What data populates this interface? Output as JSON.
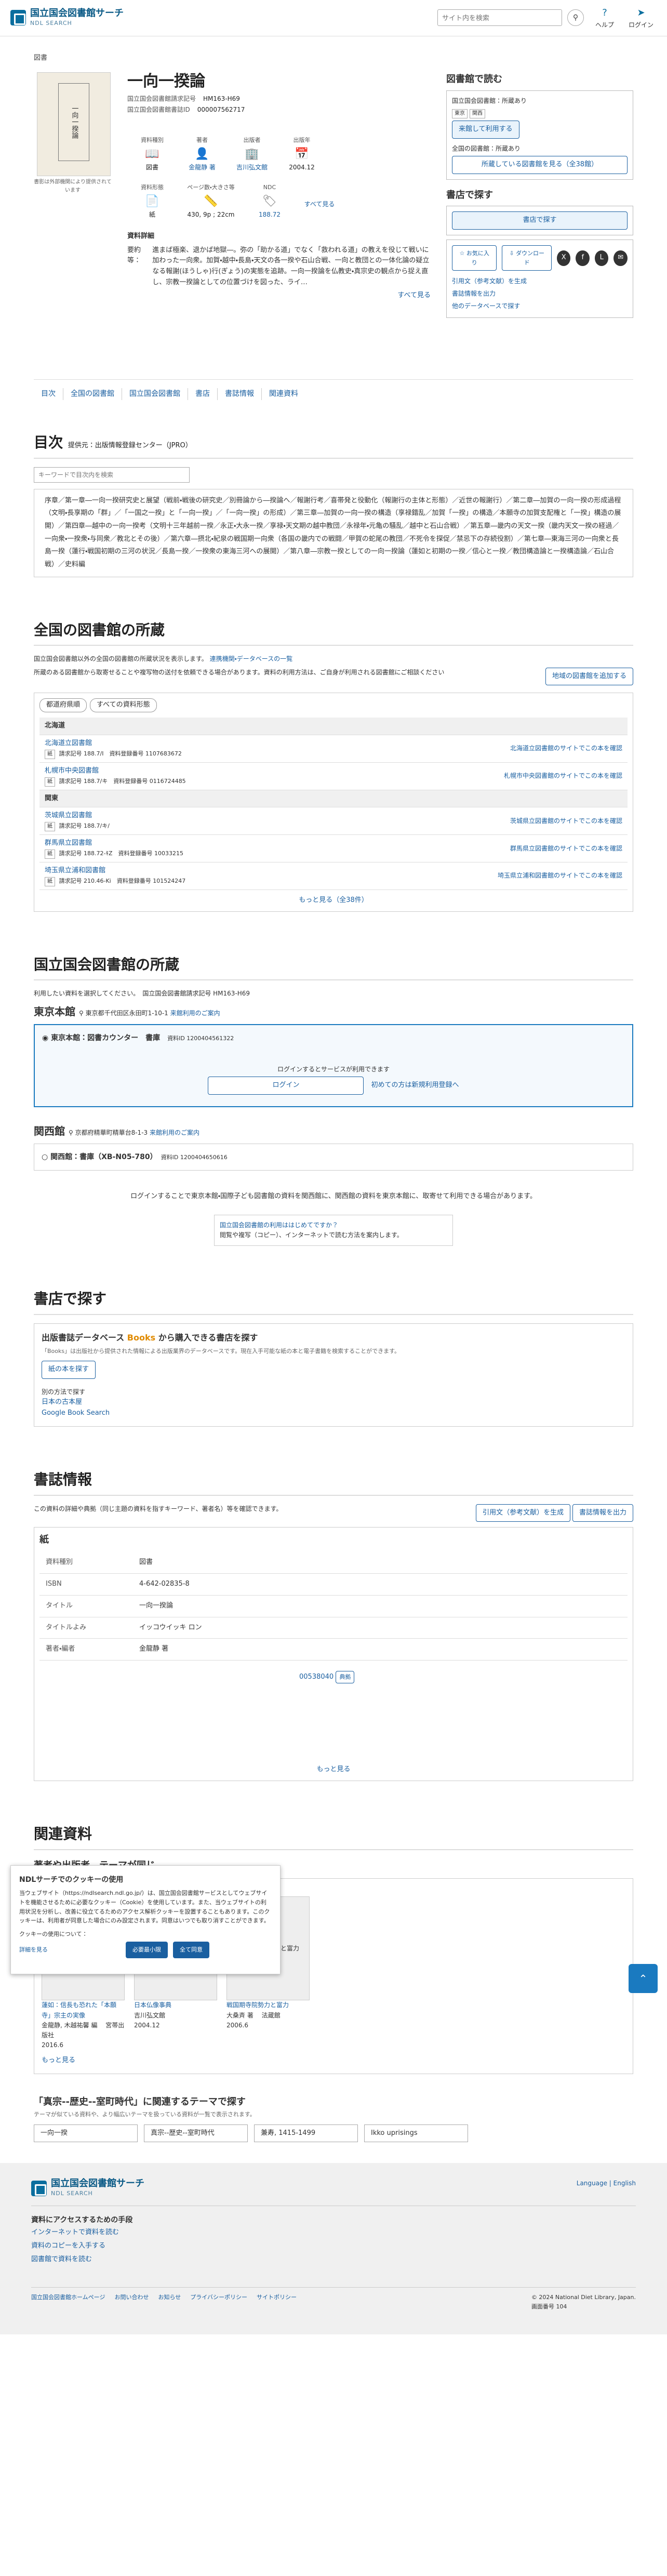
{
  "header": {
    "logo_line1": "国立国会図書館サーチ",
    "logo_line2": "NDL SEARCH",
    "search_placeholder": "サイト内を検索",
    "help": "ヘルプ",
    "login": "ログイン"
  },
  "book": {
    "category": "図書",
    "cover_note": "書影は外部機関により提供されています",
    "title": "一向一揆論",
    "call_no_label": "国立国会図書館請求記号",
    "call_no": "HM163-H69",
    "id_label": "国立国会図書館書誌ID",
    "id": "000007562717",
    "attrs": [
      {
        "k": "資料種別",
        "v": "図書"
      },
      {
        "k": "著者",
        "v": "金龍静 著"
      },
      {
        "k": "出版者",
        "v": "吉川弘文館"
      },
      {
        "k": "出版年",
        "v": "2004.12"
      }
    ],
    "attrs2": [
      {
        "k": "資料形態",
        "v": "紙"
      },
      {
        "k": "ページ数・大きさ等",
        "v": "430, 9p ; 22cm"
      },
      {
        "k": "NDC",
        "v": "188.72"
      }
    ],
    "see_all": "すべて見る",
    "summary_head": "資料詳細",
    "summary_key": "要約等：",
    "summary": "進まば極楽、退かば地獄―。弥の「助かる道」でなく「救われる道」の教えを役じて戦いに加わった一向衆。加賀・越中・長島・天文の各一揆や石山合戦、一向と教団との一体化論の疑立なる報謝(ほうしゃ)行(ぎょう)の実態を追跡。一向一揆論を仏教史・真宗史の観点から捉え直し、宗教一揆論としての位置づけを図った、ライ…",
    "more": "すべて見る"
  },
  "side": {
    "read_head": "図書館で読む",
    "ndl_label": "国立国会図書館：所蔵あり",
    "tags": [
      "東京",
      "関西"
    ],
    "ndl_btn": "来館して利用する",
    "zenkoku_label": "全国の図書館：所蔵あり",
    "zenkoku_btn": "所蔵している図書館を見る（全38館）",
    "buy_head": "書店で探す",
    "buy_btn": "書店で探す",
    "fav": "お気に入り",
    "dl": "ダウンロード",
    "links": [
      "引用文（参考文献）を生成",
      "書誌情報を出力",
      "他のデータベースで探す"
    ]
  },
  "tabs": [
    "目次",
    "全国の図書館",
    "国立国会図書館",
    "書店",
    "書誌情報",
    "関連資料"
  ],
  "toc": {
    "head": "目次",
    "provider": "提供元：出版情報登録センター（JPRO）",
    "search_placeholder": "キーワードで目次内を検索",
    "body": "序章／第一章―一向一揆研究史と展望（戦前・戦後の研究史／別冊論から―揆論へ／報謝行考／喜帯発と役動化（報謝行の主体と形態）／近世の報謝行）／第二章―加賀の一向一揆の形成過程（文明・長享期の「群」／「一国之一揆」と「一向一揆」／「一向一揆」の形成）／第三章―加賀の一向一揆の構造（享禄錯乱／加賀「一揆」の構造／本願寺の加賀支配権と「一揆」構造の展開）／第四章―越中の一向一揆考（文明十三年越前一揆／永正・大永一揆／享禄・天文期の越中教団／永禄年・元亀の騒乱／越中と石山合戦）／第五章―畿内の天文一揆（畿内天文一揆の経過／一向衆・一揆衆・与同衆／教北とその後）／第六章―摂北・紀泉の戦国期一向衆（各国の畿内での戦闘／甲賀の蛇尾の教団／不死令を探促／禁忌下の存続役割）／第七章―東海三河の一向衆と長島一揆（蓮行・戦国初期の三河の状況／長島一揆／一揆衆の東海三河への展開）／第八章―宗教一揆としての一向一揆論（蓮如と初期の一揆／信心と一揆／教団構造論と一揆構造論／石山合戦）／史料編"
  },
  "libs": {
    "head": "全国の図書館の所蔵",
    "note1": "国立国会図書館以外の全国の図書館の所蔵状況を表示します。",
    "link1": "連携機関・データベースの一覧",
    "note2": "所蔵のある図書館から取寄せることや複写物の送付を依頼できる場合があります。資料の利用方法は、ご自身が利用される図書館にご相談ください",
    "add_btn": "地域の図書館を追加する",
    "filters": [
      "都道府県順",
      "すべての資料形態"
    ],
    "regions": [
      {
        "name": "北海道",
        "rows": [
          {
            "lib": "北海道立図書館",
            "form": "紙",
            "call": "請求記号 188.7/I",
            "reg": "資料登録番号 1107683672",
            "link": "北海道立図書館のサイトでこの本を確認"
          },
          {
            "lib": "札幌市中央図書館",
            "form": "紙",
            "call": "請求記号 188.7/キ",
            "reg": "資料登録番号 0116724485",
            "link": "札幌市中央図書館のサイトでこの本を確認"
          }
        ]
      },
      {
        "name": "関東",
        "rows": [
          {
            "lib": "茨城県立図書館",
            "form": "紙",
            "call": "請求記号 188.7/キ/",
            "reg": "",
            "link": "茨城県立図書館のサイトでこの本を確認"
          },
          {
            "lib": "群馬県立図書館",
            "form": "紙",
            "call": "請求記号 188.72-ｷZ",
            "reg": "資料登録番号 10033215",
            "link": "群馬県立図書館のサイトでこの本を確認"
          },
          {
            "lib": "埼玉県立浦和図書館",
            "form": "紙",
            "call": "請求記号 210.46-Ki",
            "reg": "資料登録番号 101524247",
            "link": "埼玉県立浦和図書館のサイトでこの本を確認"
          }
        ]
      }
    ],
    "more": "もっと見る（全38件）"
  },
  "ndl": {
    "head": "国立国会図書館の所蔵",
    "note": "利用したい資料を選択してください。",
    "call_label": "国立国会図書館請求記号",
    "call": "HM163-H69",
    "tokyo": "東京本館",
    "tokyo_addr": "東京都千代田区永田町1-10-1",
    "guide": "来館利用のご案内",
    "tokyo_item": "東京本館：図書カウンター　書庫",
    "tokyo_id": "資料ID 1200404561322",
    "login_note": "ログインするとサービスが利用できます",
    "login_btn": "ログイン",
    "register": "初めての方は新規利用登録へ",
    "kansai": "関西館",
    "kansai_addr": "京都府精華町精華台8-1-3",
    "kansai_item": "関西館：書庫（XB-N05-780）",
    "kansai_id": "資料ID 1200404650616",
    "transfer": "ログインすることで東京本館・国際子ども図書館の資料を関西館に、関西館の資料を東京本館に、取寄せて利用できる場合があります。",
    "first_q": "国立国会図書館の利用ははじめてですか？",
    "first_sub": "閲覧や複写（コピー）、インターネットで読む方法を案内します。"
  },
  "shop": {
    "head": "書店で探す",
    "line": "出版書誌データベース",
    "brand": "Books",
    "line2": "から購入できる書店を探す",
    "note": "「Books」は出版社から提供された情報による出版業界のデータベースです。現在入手可能な紙の本と電子書籍を検索することができます。",
    "btn": "紙の本を探す",
    "other": "別の方法で探す",
    "links": [
      "日本の古本屋",
      "Google Book Search"
    ]
  },
  "bib": {
    "head": "書誌情報",
    "note": "この資料の詳細や典拠（同じ主題の資料を指すキーワード、著者名）等を確認できます。",
    "cite": "引用文（参考文献）を生成",
    "export": "書誌情報を出力",
    "format": "紙",
    "rows": [
      {
        "k": "資料種別",
        "v": "図書"
      },
      {
        "k": "ISBN",
        "v": "4-642-02835-8"
      },
      {
        "k": "タイトル",
        "v": "一向一揆論"
      },
      {
        "k": "タイトルよみ",
        "v": "イッコウイッキ ロン"
      },
      {
        "k": "著者・編者",
        "v": "金龍静 著"
      }
    ],
    "more": "もっと見る",
    "auth_id": "00538040",
    "auth_btn": "典拠"
  },
  "related": {
    "head": "関連資料",
    "sub": "著者や出版者、テーマが同じ",
    "items": [
      {
        "tag": "同じ著者",
        "title": "蓮如：信長も恐れた「本願寺」宗主の実像",
        "pub": "金龍静, 木越祐馨 編 　宮帯出版社",
        "year": "2016.6",
        "book": "蓮如 信長も恐れた「本願寺」宗主の実像"
      },
      {
        "tag": "同じ出版者",
        "title": "日本仏像事典",
        "pub": "吉川弘文館",
        "year": "2004.12",
        "book": "日本仏像事典"
      },
      {
        "tag": "同じテーマ",
        "title": "戦国期寺院勢力と富力",
        "pub": "大桑斉 著 　法蔵館",
        "year": "2006.6",
        "book": "戦国期寺院勢力と富力"
      }
    ],
    "more": "もっと見る"
  },
  "theme": {
    "head": "「真宗--歴史--室町時代」に関連するテーマで探す",
    "sub": "テーマが似ている資料や、より幅広いテーマを扱っている資料が一覧で表示されます。",
    "tags": [
      "一向一揆",
      "真宗--歴史--室町時代",
      "兼寿, 1415-1499",
      "Ikko uprisings"
    ]
  },
  "cookie": {
    "head": "NDLサーチでのクッキーの使用",
    "body": "当ウェブサイト（https://ndlsearch.ndl.go.jp/）は、国立国会図書館サービスとしてウェブサイトを機能させるために必要なクッキー（Cookie）を使用しています。また、当ウェブサイトの利用状況を分析し、改善に役立てるためのアクセス解析クッキーを設置することもあります。このクッキーは、利用者が同意した場合にのみ設定されます。同意はいつでも取り消すことができます。",
    "q": "クッキーの使用について：",
    "detail": "詳細を見る",
    "deny": "必要最小限",
    "accept": "全て同意"
  },
  "footer": {
    "logo1": "国立国会図書館サーチ",
    "logo2": "NDL SEARCH",
    "lang": "Language | English",
    "access_head": "資料にアクセスするための手段",
    "links": [
      "インターネットで資料を読む",
      "資料のコピーを入手する",
      "図書館で資料を読む"
    ],
    "bottom": [
      "国立国会図書館ホームページ",
      "お問い合わせ",
      "お知らせ",
      "プライバシーポリシー",
      "サイトポリシー"
    ],
    "copy": "© 2024 National Diet Library, Japan.",
    "ver": "画面番号",
    "vernum": "104"
  }
}
